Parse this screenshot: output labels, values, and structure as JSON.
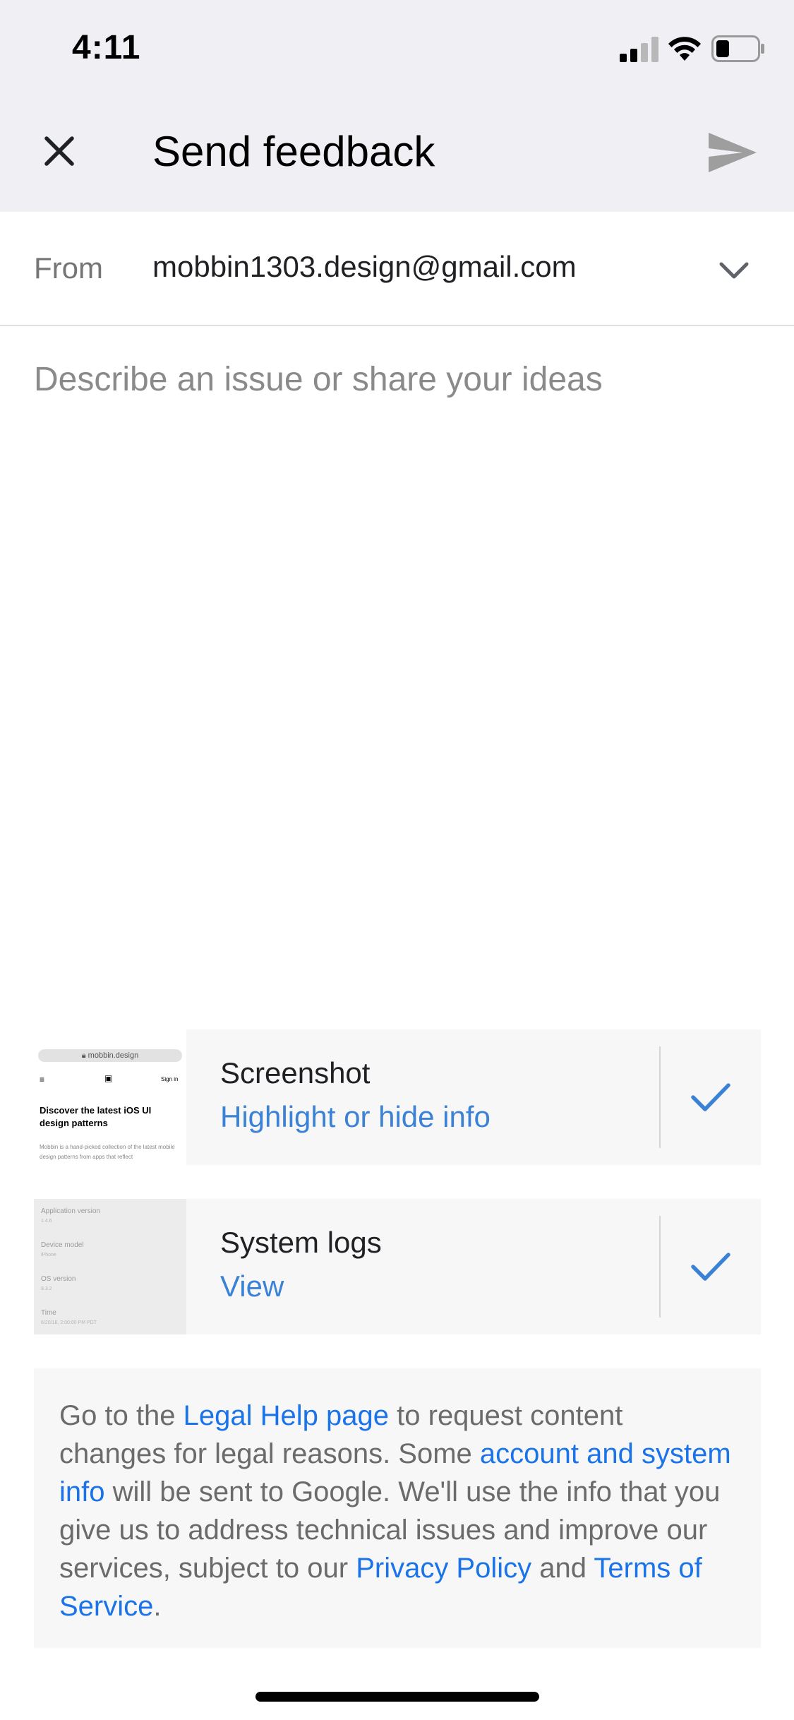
{
  "status_bar": {
    "time": "4:11"
  },
  "header": {
    "title": "Send feedback"
  },
  "from": {
    "label": "From",
    "value": "mobbin1303.design@gmail.com"
  },
  "description": {
    "placeholder": "Describe an issue or share your ideas"
  },
  "attachments": [
    {
      "title": "Screenshot",
      "link": "Highlight or hide info",
      "checked": true,
      "thumbnail": {
        "url": "mobbin.design",
        "signin": "Sign in",
        "headline": "Discover the latest iOS UI design patterns",
        "body": "Mobbin is a hand-picked collection of the latest mobile design patterns from apps that reflect"
      }
    },
    {
      "title": "System logs",
      "link": "View",
      "checked": true,
      "thumbnail": {
        "items": [
          {
            "label": "Application version",
            "value": "1.4.6"
          },
          {
            "label": "Device model",
            "value": "iPhone"
          },
          {
            "label": "OS version",
            "value": "9.3.2"
          },
          {
            "label": "Time",
            "value": "6/20/16, 2:00:00 PM PDT"
          }
        ]
      }
    }
  ],
  "legal": {
    "t1": "Go to the ",
    "link1": "Legal Help page",
    "t2": " to request content changes for legal reasons. Some ",
    "link2": "account and system info",
    "t3": " will be sent to Google. We'll use the info that you give us to address technical issues and improve our services, subject to our ",
    "link3": "Privacy Policy",
    "t4": " and ",
    "link4": "Terms of Service",
    "t5": "."
  },
  "colors": {
    "header_bg": "#efeff4",
    "link": "#1a73e8",
    "check": "#3b82d6",
    "send_disabled": "#9e9e9e"
  },
  "icons": {
    "close": "close-icon",
    "send": "send-icon",
    "chevron": "chevron-down-icon",
    "check": "check-icon"
  }
}
